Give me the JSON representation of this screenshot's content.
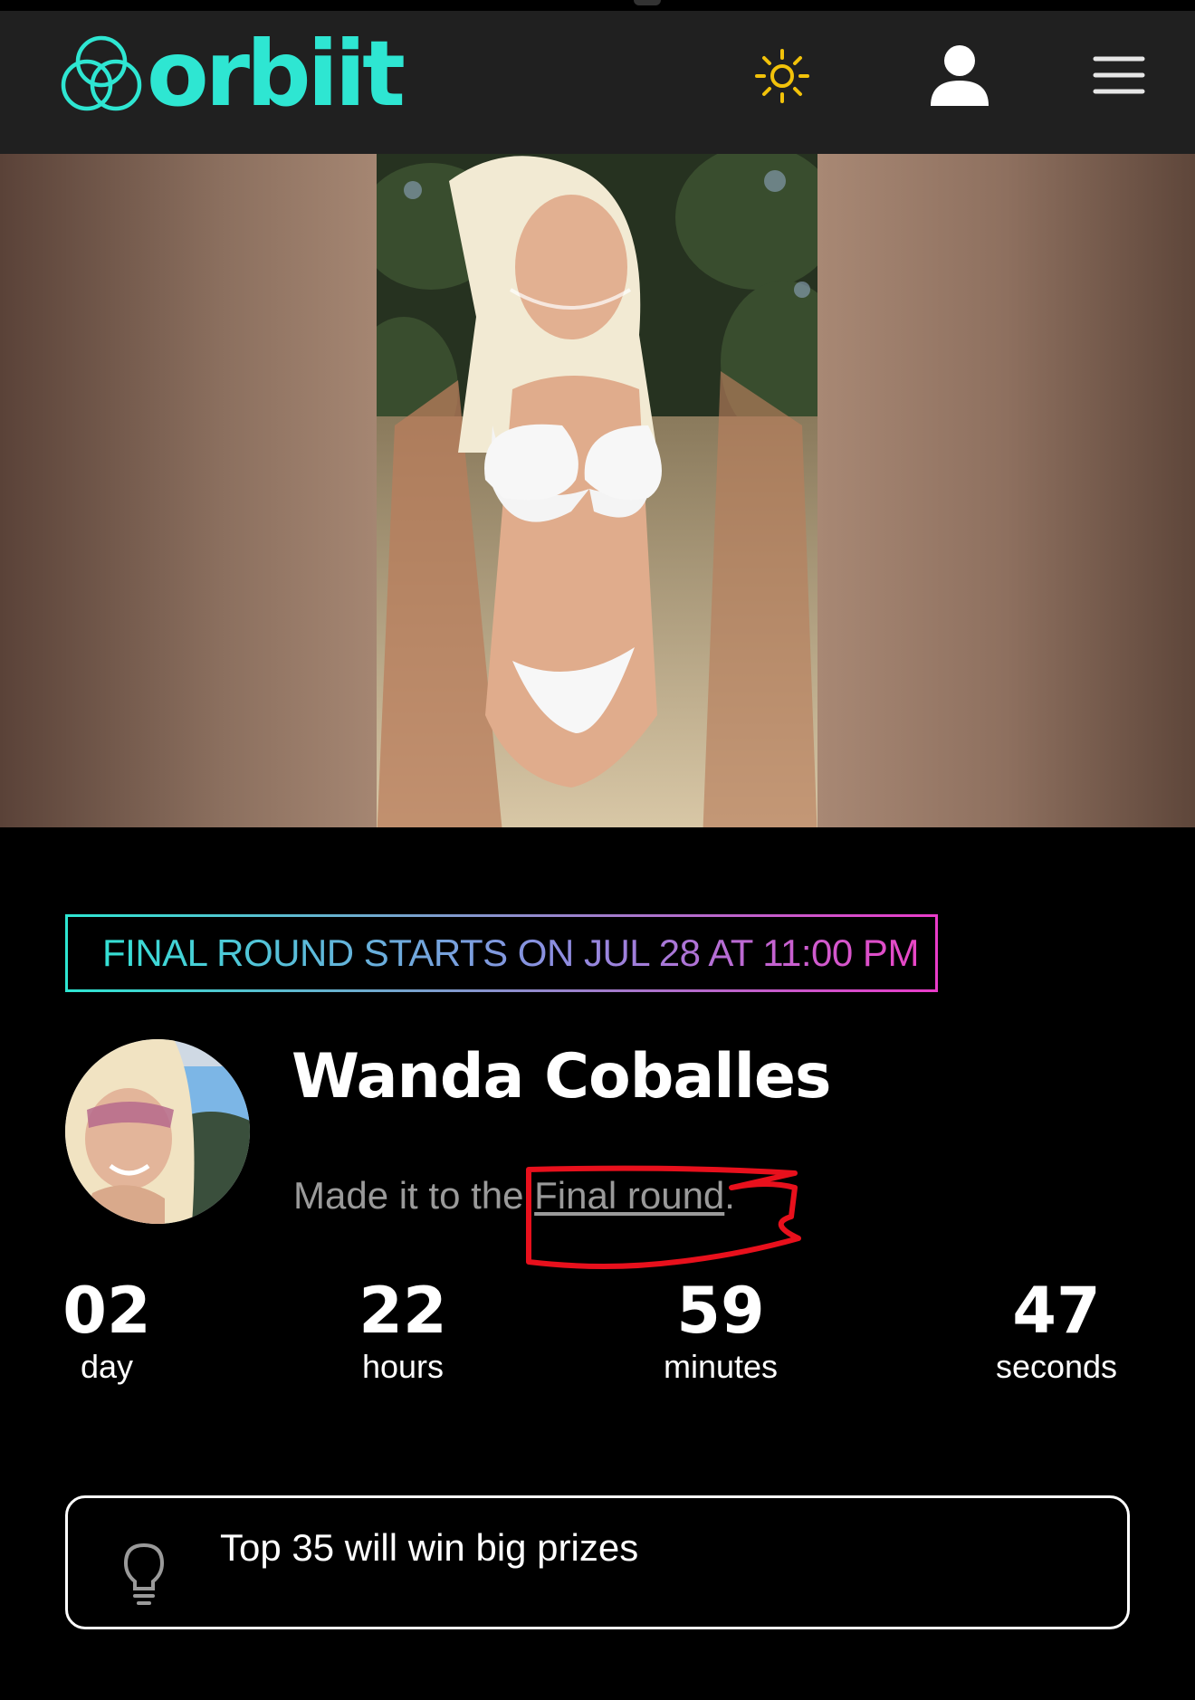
{
  "header": {
    "logo_text": "orbiit",
    "icons": [
      "sun-icon",
      "user-icon",
      "menu-icon"
    ],
    "accent": "#2ee6d2",
    "sun_color": "#f2c20a"
  },
  "banner": {
    "text": "FINAL ROUND STARTS ON JUL 28 AT 11:00 PM",
    "gradient": [
      "#2ee6d2",
      "#e93cc9"
    ]
  },
  "profile": {
    "name": "Wanda Coballes",
    "status_prefix": "Made it to the ",
    "status_link": "Final round",
    "status_suffix": "."
  },
  "countdown": [
    {
      "value": "02",
      "unit": "day"
    },
    {
      "value": "22",
      "unit": "hours"
    },
    {
      "value": "59",
      "unit": "minutes"
    },
    {
      "value": "47",
      "unit": "seconds"
    }
  ],
  "tip": {
    "text": "Top 35 will win big prizes",
    "icon": "lightbulb-icon"
  },
  "annotation_color": "#e8101c"
}
